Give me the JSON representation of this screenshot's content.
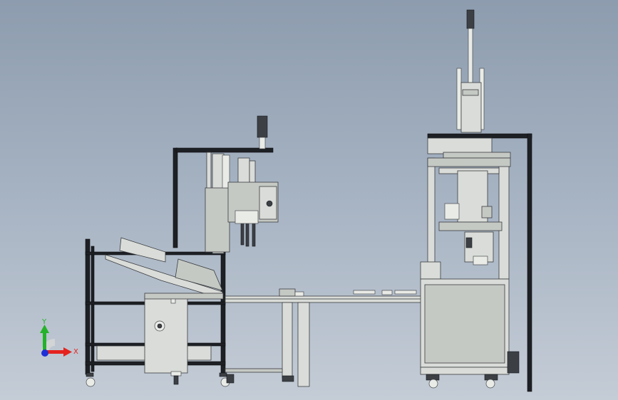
{
  "triad": {
    "x_label": "X",
    "y_label": "Y",
    "x_color": "#e5231f",
    "y_color": "#25b22a",
    "z_color": "#1f2fd6"
  },
  "colors": {
    "background_top": "#8d9cae",
    "background_bottom": "#c4ccd6",
    "frame": "#1d2024",
    "aluminum": "#d9dcd8"
  }
}
